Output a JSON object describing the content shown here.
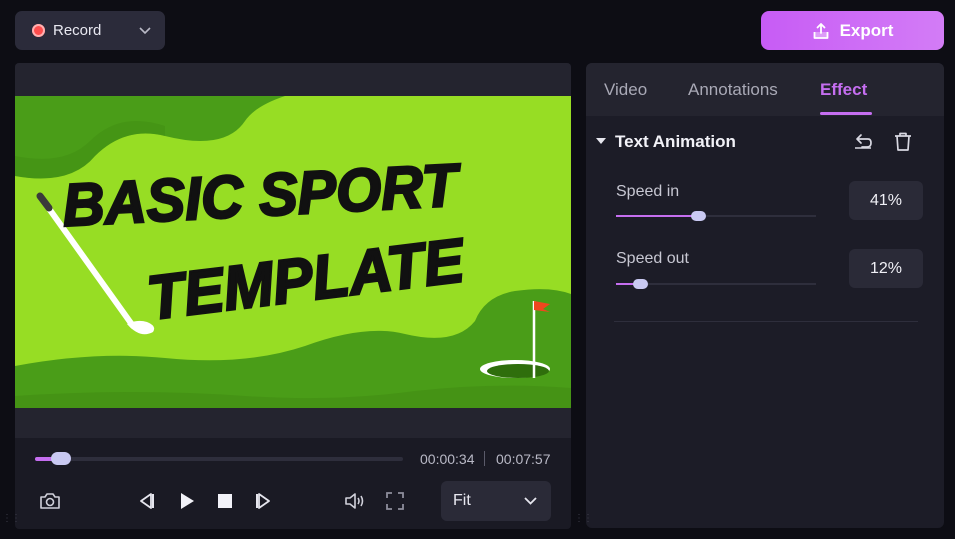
{
  "topbar": {
    "record_label": "Record",
    "export_label": "Export"
  },
  "video": {
    "headline_line1": "BASIC SPORT",
    "headline_line2": "TEMPLATE"
  },
  "player": {
    "current_time": "00:00:34",
    "total_time": "00:07:57",
    "progress": 0.071,
    "fit_label": "Fit"
  },
  "panel": {
    "tabs": [
      {
        "label": "Video",
        "active": false
      },
      {
        "label": "Annotations",
        "active": false
      },
      {
        "label": "Effect",
        "active": true
      }
    ],
    "section_title": "Text Animation",
    "params": [
      {
        "label": "Speed in",
        "value": "41%",
        "fraction": 0.41
      },
      {
        "label": "Speed out",
        "value": "12%",
        "fraction": 0.12
      }
    ]
  },
  "colors": {
    "accent": "#c56ef0",
    "export_gradient_start": "#c75cf5",
    "video_light_green": "#97dd24",
    "video_dark_green": "#4a9d18",
    "flag": "#f0461e"
  }
}
